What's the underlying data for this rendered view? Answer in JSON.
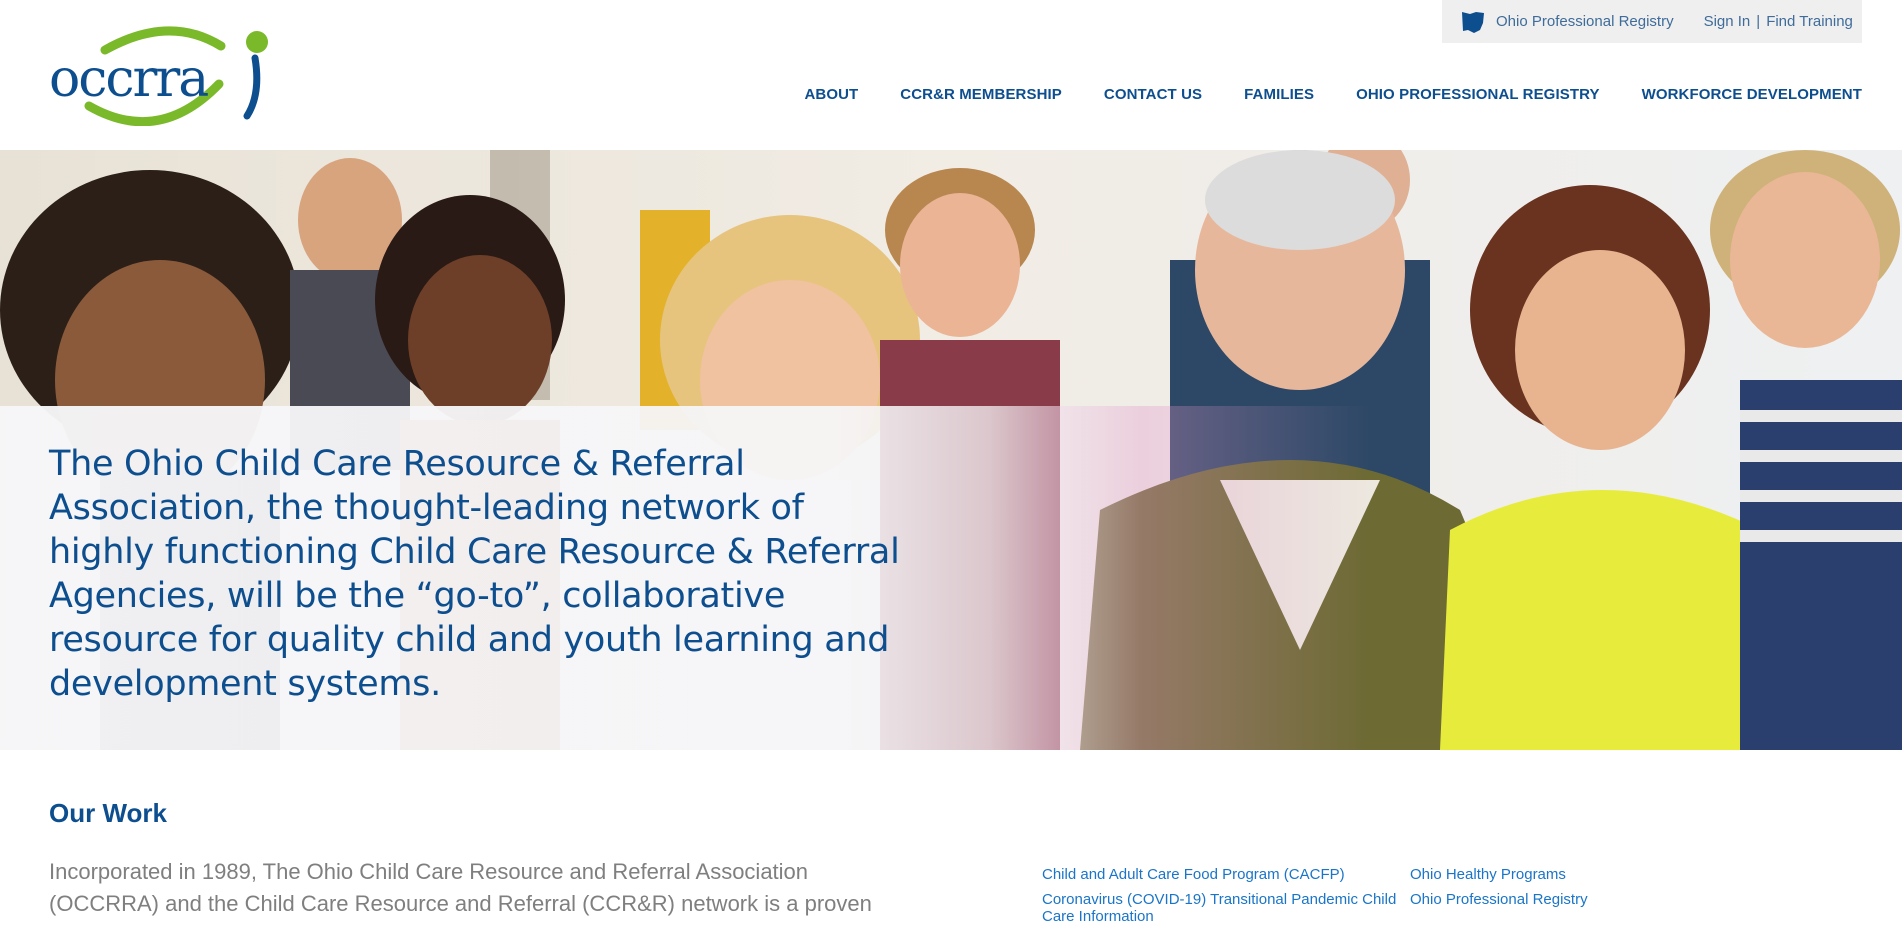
{
  "brand": {
    "logo_text": "occrra",
    "colors": {
      "primary_blue": "#0d4e8f",
      "green": "#7ab929",
      "link_blue": "#1a75c8",
      "grey_text": "#7f7f7f"
    }
  },
  "utility": {
    "registry_icon": "ohio-state-icon",
    "registry_link": "Ohio Professional Registry",
    "sign_in": "Sign In",
    "separator": "|",
    "find_training": "Find Training"
  },
  "nav": {
    "search_icon": "search-icon",
    "items": [
      "ABOUT",
      "CCR&R MEMBERSHIP",
      "CONTACT US",
      "FAMILIES",
      "OHIO PROFESSIONAL REGISTRY",
      "WORKFORCE DEVELOPMENT"
    ]
  },
  "hero": {
    "image": "group-of-smiling-adults-photo",
    "statement": "The Ohio Child Care Resource & Referral Association, the thought-leading network of highly functioning Child Care Resource & Referral Agencies, will be the “go-to”, collaborative resource for quality child and youth learning and development systems."
  },
  "our_work": {
    "title": "Our Work",
    "intro": "Incorporated in 1989, The Ohio Child Care Resource and Referral Association (OCCRRA) and the Child Care Resource and Referral (CCR&R) network is a proven",
    "links": [
      "Child and Adult Care Food Program (CACFP)",
      "Ohio Healthy Programs",
      "Coronavirus (COVID-19) Transitional Pandemic Child Care Information",
      "Ohio Professional Registry"
    ]
  }
}
